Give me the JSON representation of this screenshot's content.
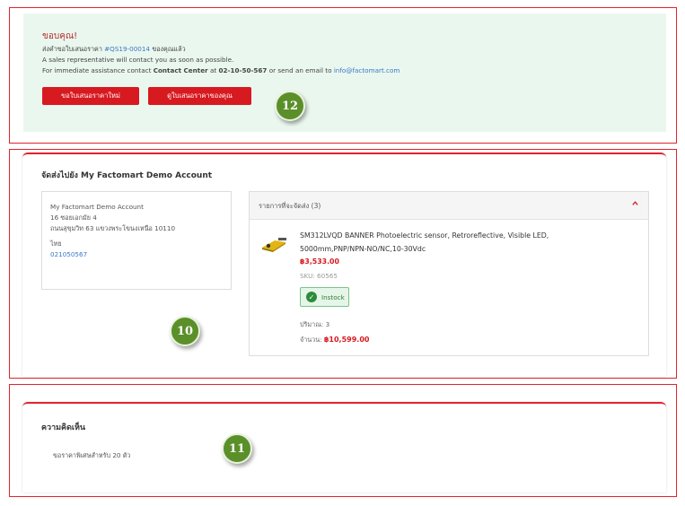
{
  "thanks": {
    "title": "ขอบคุณ!",
    "line1_prefix": "ส่งคำขอใบเสนอราคา",
    "quote_number": "#QS19-00014",
    "line1_suffix": "ของคุณแล้ว",
    "line2": "A sales representative will contact you as soon as possible.",
    "line3_prefix": "For immediate assistance contact",
    "contact_center": "Contact Center",
    "at": "at",
    "phone": "02-10-50-567",
    "line3_mid": "or send an email to",
    "email": "info@factomart.com",
    "new_quote_button": "ขอใบเสนอราคาใหม่",
    "view_quote_button": "ดูใบเสนอราคาของคุณ"
  },
  "shipping": {
    "title": "จัดส่งไปยัง My Factomart Demo Account",
    "address": {
      "name": "My Factomart Demo Account",
      "line1": "16 ซอยเอกมัย 4",
      "line2": "ถนนสุขุมวิท 63 แขวงพระโขนงเหนือ 10110",
      "country": "ไทย",
      "phone": "021050567"
    },
    "items_header": "รายการที่จะจัดส่ง (3)",
    "product": {
      "name": "SM312LVQD BANNER Photoelectric sensor, Retroreflective, Visible LED, 5000mm,PNP/NPN-NO/NC,10-30Vdc",
      "price": "฿3,533.00",
      "sku": "SKU: 60565",
      "stock_status": "Instock",
      "quantity_label": "ปริมาณ: 3",
      "total_label": "จำนวน:",
      "total_value": "฿10,599.00"
    }
  },
  "comments": {
    "title": "ความคิดเห็น",
    "text": "ขอราคาพิเศษสำหรับ 20 ตัว"
  },
  "badges": {
    "thanks_section": "12",
    "shipping_section": "10",
    "comments_section": "11"
  },
  "colors": {
    "accent": "#d71920",
    "success_bg": "#eaf7ee",
    "badge": "#5b8f2a",
    "link": "#3a78c8"
  },
  "icons": {
    "collapse": "chevron-up-icon",
    "stock": "check-circle-icon",
    "product": "photoelectric-sensor-image"
  }
}
